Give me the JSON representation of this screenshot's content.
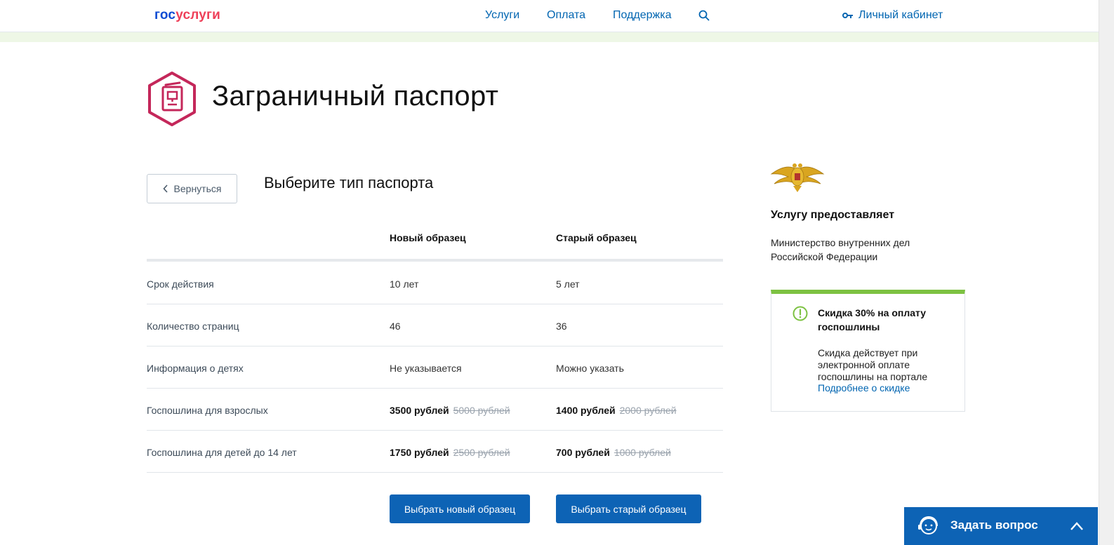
{
  "header": {
    "logo_part1": "гос",
    "logo_part2": "услуги",
    "nav": [
      "Услуги",
      "Оплата",
      "Поддержка"
    ],
    "search_icon": "search-icon",
    "cabinet_label": "Личный кабинет",
    "cabinet_icon": "key-icon"
  },
  "page": {
    "title": "Заграничный паспорт",
    "title_icon": "passport-icon",
    "back_label": "Вернуться",
    "section_title": "Выберите тип паспорта"
  },
  "table": {
    "columns": [
      "Новый образец",
      "Старый образец"
    ],
    "rows": [
      {
        "label": "Срок действия",
        "new": "10 лет",
        "old": "5 лет"
      },
      {
        "label": "Количество страниц",
        "new": "46",
        "old": "36"
      },
      {
        "label": "Информация о детях",
        "new": "Не указывается",
        "old": "Можно указать"
      },
      {
        "label": "Госпошлина для взрослых",
        "new_price": "3500 рублей",
        "new_old_price": "5000 рублей",
        "old_price": "1400 рублей",
        "old_old_price": "2000 рублей"
      },
      {
        "label": "Госпошлина для детей до 14 лет",
        "new_price": "1750 рублей",
        "new_old_price": "2500 рублей",
        "old_price": "700 рублей",
        "old_old_price": "1000 рублей"
      }
    ]
  },
  "actions": {
    "choose_new": "Выбрать новый образец",
    "choose_old": "Выбрать старый образец"
  },
  "provider": {
    "emblem_icon": "mvd-emblem-icon",
    "title": "Услугу предоставляет",
    "name": "Министерство внутренних дел Российской Федерации"
  },
  "discount": {
    "icon": "exclamation-icon",
    "title": "Скидка 30% на оплату госпошлины",
    "text": "Скидка действует при электронной оплате госпошлины на портале",
    "link": "Подробнее о скидке",
    "accent": "#7dc242"
  },
  "ask": {
    "label": "Задать вопрос",
    "icon": "support-face-icon"
  },
  "colors": {
    "brand_blue": "#0d4cd3",
    "brand_red": "#ee3f58",
    "link": "#0065b1",
    "button": "#0d63b5",
    "passport_icon": "#c4275a"
  }
}
